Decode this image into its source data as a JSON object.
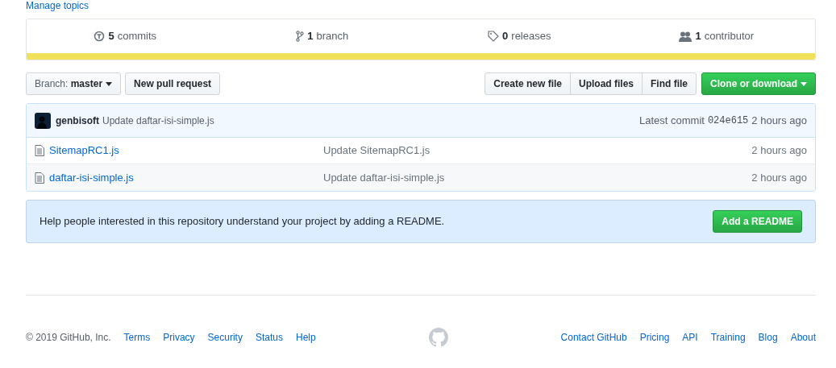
{
  "topics_link": "Manage topics",
  "stats": [
    {
      "kind": "commits",
      "count": "5",
      "label": "commits"
    },
    {
      "kind": "branch",
      "count": "1",
      "label": "branch"
    },
    {
      "kind": "releases",
      "count": "0",
      "label": "releases"
    },
    {
      "kind": "contributors",
      "count": "1",
      "label": "contributor"
    }
  ],
  "language_bar": {
    "color": "#f1e05a"
  },
  "branch_button": {
    "label": "Branch:",
    "value": "master"
  },
  "new_pull_request": "New pull request",
  "file_buttons": [
    "Create new file",
    "Upload files",
    "Find file"
  ],
  "clone_button": "Clone or download",
  "commit": {
    "author": "genbisoft",
    "message": "Update daftar-isi-simple.js",
    "prefix": "Latest commit",
    "sha": "024e615",
    "time": "2 hours ago"
  },
  "files": [
    {
      "name": "SitemapRC1.js",
      "message": "Update SitemapRC1.js",
      "time": "2 hours ago"
    },
    {
      "name": "daftar-isi-simple.js",
      "message": "Update daftar-isi-simple.js",
      "time": "2 hours ago"
    }
  ],
  "readme": {
    "text": "Help people interested in this repository understand your project by adding a README.",
    "button": "Add a README"
  },
  "footer": {
    "copyright": "© 2019 GitHub, Inc.",
    "left_links": [
      "Terms",
      "Privacy",
      "Security",
      "Status",
      "Help"
    ],
    "right_links": [
      "Contact GitHub",
      "Pricing",
      "API",
      "Training",
      "Blog",
      "About"
    ]
  }
}
